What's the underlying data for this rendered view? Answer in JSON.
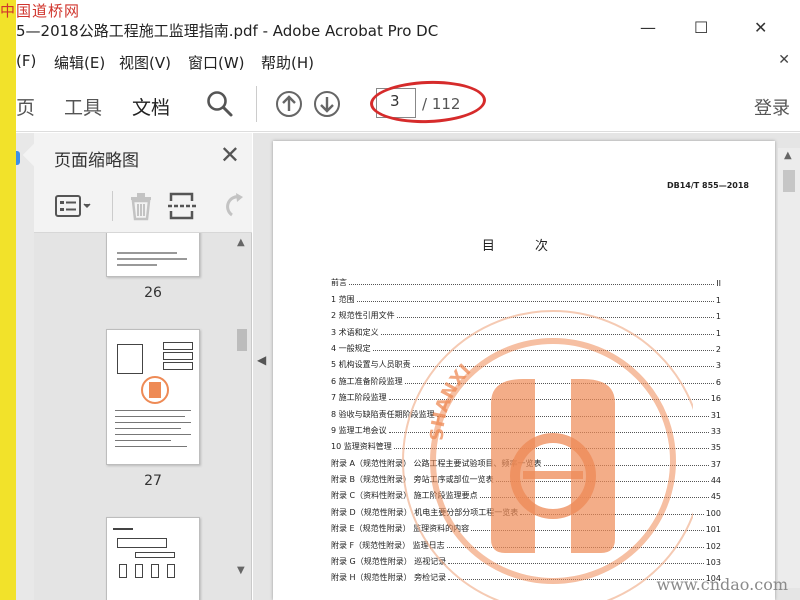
{
  "watermark": {
    "top": "中国道桥网",
    "bottom": "www.cndao.com"
  },
  "window": {
    "title": "5—2018公路工程施工监理指南.pdf - Adobe Acrobat Pro DC",
    "minimize": "—",
    "maximize": "☐",
    "close": "✕"
  },
  "menu": {
    "items": [
      "(F)",
      "编辑(E)",
      "视图(V)",
      "窗口(W)",
      "帮助(H)"
    ],
    "close_doc": "✕"
  },
  "toolbar": {
    "tabs": [
      {
        "label": "页"
      },
      {
        "label": "工具"
      },
      {
        "label": "文档"
      }
    ],
    "page_current": "3",
    "page_total": "/ 112",
    "login": "登录"
  },
  "panel": {
    "title": "页面缩略图",
    "close": "✕",
    "thumbnails": [
      {
        "num": "26"
      },
      {
        "num": "27"
      }
    ]
  },
  "document": {
    "code": "DB14/T 855—2018",
    "heading": "目 次",
    "toc": [
      {
        "label": "前言",
        "page": "II"
      },
      {
        "label": "1  范围",
        "page": "1"
      },
      {
        "label": "2  规范性引用文件",
        "page": "1"
      },
      {
        "label": "3  术语和定义",
        "page": "1"
      },
      {
        "label": "4  一般规定",
        "page": "2"
      },
      {
        "label": "5  机构设置与人员职责",
        "page": "3"
      },
      {
        "label": "6  施工准备阶段监理",
        "page": "6"
      },
      {
        "label": "7  施工阶段监理",
        "page": "16"
      },
      {
        "label": "8  验收与缺陷责任期阶段监理",
        "page": "31"
      },
      {
        "label": "9  监理工地会议",
        "page": "33"
      },
      {
        "label": "10  监理资料管理",
        "page": "35"
      },
      {
        "label": "附录 A（规范性附录）  公路工程主要试验项目、频率一览表",
        "page": "37"
      },
      {
        "label": "附录 B（规范性附录）  旁站工序或部位一览表",
        "page": "44"
      },
      {
        "label": "附录 C（资料性附录）  施工阶段监理要点",
        "page": "45"
      },
      {
        "label": "附录 D（规范性附录）  机电主要分部分项工程一览表",
        "page": "100"
      },
      {
        "label": "附录 E（规范性附录）  监理资料的内容",
        "page": "101"
      },
      {
        "label": "附录 F（规范性附录）  监理日志",
        "page": "102"
      },
      {
        "label": "附录 G（规范性附录）  巡视记录",
        "page": "103"
      },
      {
        "label": "附录 H（规范性附录）  旁检记录",
        "page": "104"
      }
    ],
    "stamp_text": "SHANXI"
  },
  "colors": {
    "accent": "#d62b2b",
    "stamp": "#ee8a55",
    "watermark": "#d0342c"
  }
}
